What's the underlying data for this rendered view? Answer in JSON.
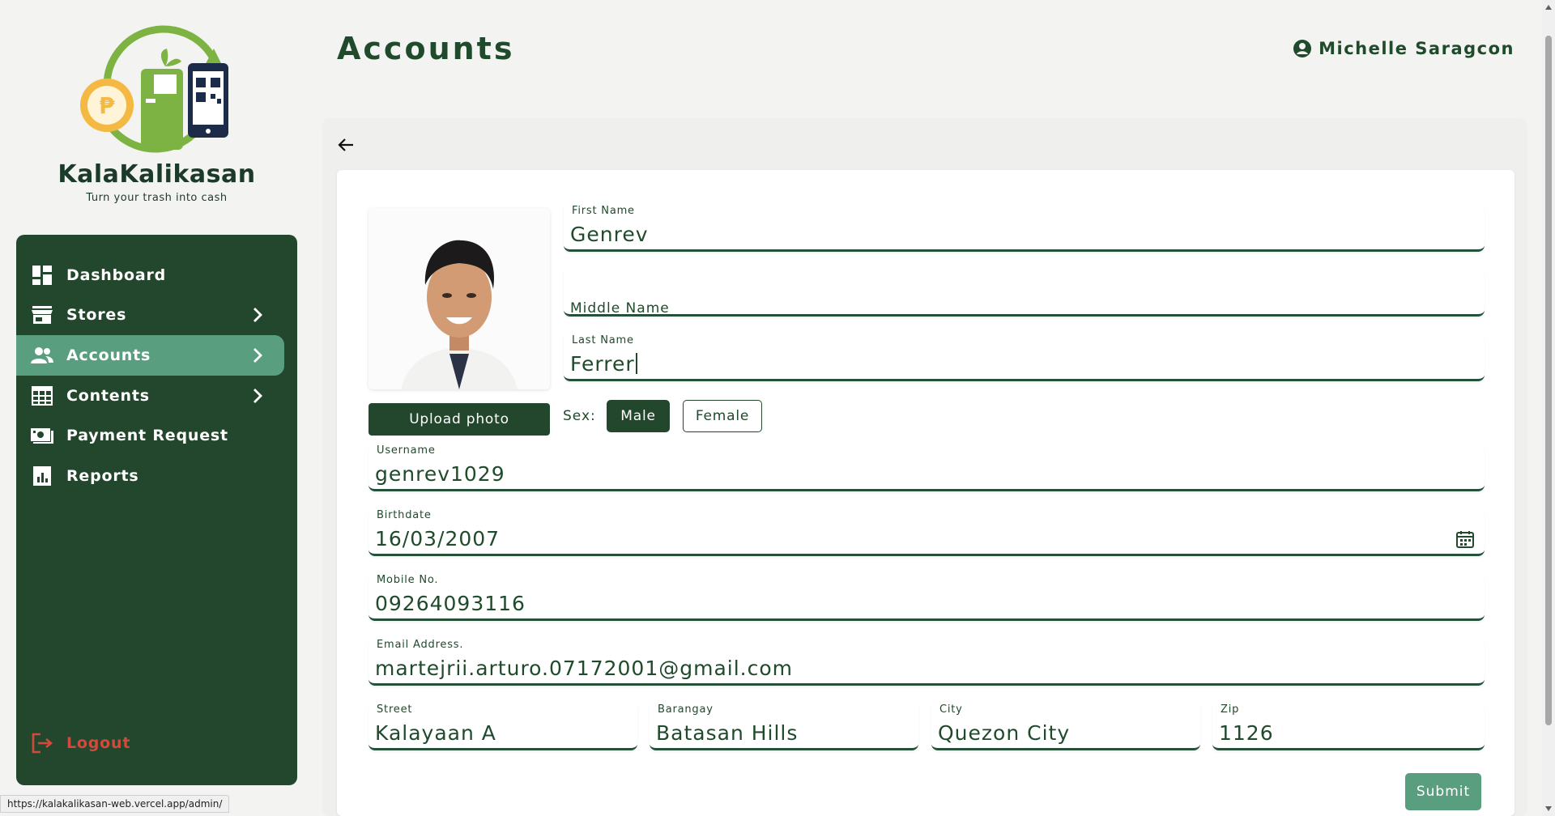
{
  "brand": {
    "name": "KalaKalikasan",
    "tagline": "Turn your trash into cash"
  },
  "sidebar": {
    "items": [
      {
        "label": "Dashboard",
        "icon": "dashboard-icon",
        "has_chevron": false,
        "active": false
      },
      {
        "label": "Stores",
        "icon": "store-icon",
        "has_chevron": true,
        "active": false
      },
      {
        "label": "Accounts",
        "icon": "users-icon",
        "has_chevron": true,
        "active": true
      },
      {
        "label": "Contents",
        "icon": "calendar-grid-icon",
        "has_chevron": true,
        "active": false
      },
      {
        "label": "Payment Request",
        "icon": "cash-icon",
        "has_chevron": false,
        "active": false
      },
      {
        "label": "Reports",
        "icon": "report-chart-icon",
        "has_chevron": false,
        "active": false
      }
    ],
    "logout_label": "Logout"
  },
  "header": {
    "title": "Accounts",
    "user_name": "Michelle Saragcon"
  },
  "form": {
    "upload_label": "Upload photo",
    "first_name": {
      "label": "First Name",
      "value": "Genrev"
    },
    "middle_name": {
      "placeholder": "Middle Name"
    },
    "last_name": {
      "label": "Last Name",
      "value": "Ferrer"
    },
    "sex": {
      "label": "Sex:",
      "options": [
        "Male",
        "Female"
      ],
      "selected": "Male"
    },
    "username": {
      "label": "Username",
      "value": "genrev1029"
    },
    "birthdate": {
      "label": "Birthdate",
      "value": "16/03/2007"
    },
    "mobile": {
      "label": "Mobile No.",
      "value": "09264093116"
    },
    "email": {
      "label": "Email Address.",
      "value": "martejrii.arturo.07172001@gmail.com"
    },
    "street": {
      "label": "Street",
      "value": "Kalayaan A"
    },
    "barangay": {
      "label": "Barangay",
      "value": "Batasan Hills"
    },
    "city": {
      "label": "City",
      "value": "Quezon City"
    },
    "zip": {
      "label": "Zip",
      "value": "1126"
    },
    "submit_label": "Submit"
  },
  "status_bar": {
    "url": "https://kalakalikasan-web.vercel.app/admin/"
  },
  "colors": {
    "primary": "#23472c",
    "accent": "#5a9e80",
    "danger": "#d24a3c",
    "text": "#1f4a2b"
  }
}
